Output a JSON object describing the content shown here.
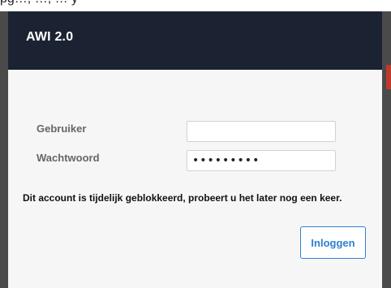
{
  "window": {
    "cropped_top_text": "pg…, …, … y"
  },
  "dialog": {
    "title": "AWI 2.0",
    "fields": {
      "user_label": "Gebruiker",
      "user_value": "",
      "password_label": "Wachtwoord",
      "password_value": "•••••••••"
    },
    "message": "Dit account is tijdelijk geblokkeerd, probeert u het later nog een keer.",
    "login_label": "Inloggen"
  },
  "colors": {
    "header_bg": "#1b2333",
    "panel_bg": "#f6f6f6",
    "accent_blue": "#2f7fd1",
    "side_bars": "#4a4a4a"
  }
}
